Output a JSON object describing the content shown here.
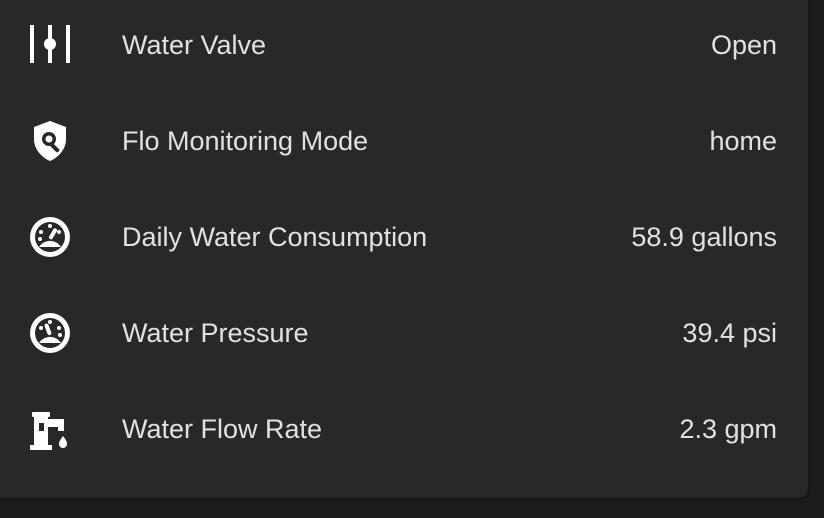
{
  "entities": [
    {
      "icon": "valve-icon",
      "name": "Water Valve",
      "state": "Open"
    },
    {
      "icon": "shield-search-icon",
      "name": "Flo Monitoring Mode",
      "state": "home"
    },
    {
      "icon": "gauge-icon",
      "name": "Daily Water Consumption",
      "state": "58.9 gallons"
    },
    {
      "icon": "gauge-icon",
      "name": "Water Pressure",
      "state": "39.4 psi"
    },
    {
      "icon": "water-pump-icon",
      "name": "Water Flow Rate",
      "state": "2.3 gpm"
    }
  ],
  "colors": {
    "background": "#1c1c1c",
    "card": "#282828",
    "text": "#e1e1e1",
    "icon": "#ffffff"
  }
}
